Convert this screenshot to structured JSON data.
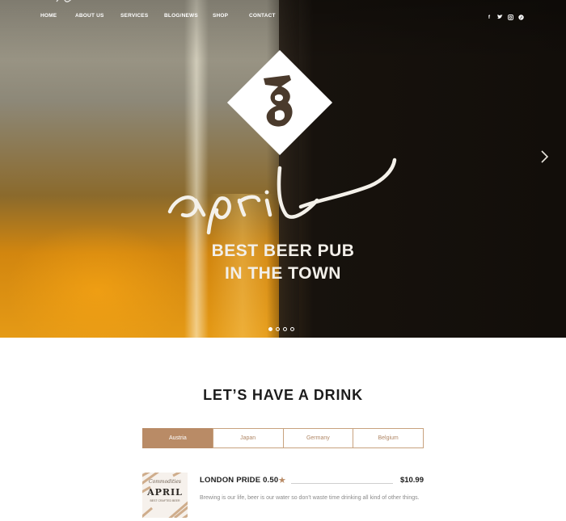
{
  "nav": {
    "items": [
      {
        "label": "HOME"
      },
      {
        "label": "ABOUT US"
      },
      {
        "label": "SERVICES"
      },
      {
        "label": "BLOG/NEWS"
      },
      {
        "label": "SHOP"
      },
      {
        "label": "CONTACT"
      }
    ]
  },
  "social": {
    "icons": [
      {
        "name": "facebook-icon",
        "glyph": "f"
      },
      {
        "name": "twitter-icon",
        "glyph": "ᵛ"
      },
      {
        "name": "instagram-icon",
        "glyph": "▣"
      },
      {
        "name": "pinterest-icon",
        "glyph": "☉"
      }
    ]
  },
  "hero": {
    "script_word": "april",
    "tagline_line1": "BEST BEER PUB",
    "tagline_line2": "IN THE TOWN",
    "slides_total": 4,
    "slide_active": 1
  },
  "menu": {
    "heading": "LET’S HAVE A DRINK",
    "tabs": [
      {
        "label": "Austria",
        "active": true
      },
      {
        "label": "Japan",
        "active": false
      },
      {
        "label": "Germany",
        "active": false
      },
      {
        "label": "Belgium",
        "active": false
      }
    ],
    "products": [
      {
        "name": "LONDON PRIDE 0.50",
        "price": "$10.99",
        "description": "Brewing is our life, beer is our water so don’t waste time drinking all kind of other things.",
        "thumb_script": "Commodities",
        "thumb_title": "APRIL",
        "thumb_sub": "BEST CRAFTED BEER"
      }
    ]
  },
  "colors": {
    "accent": "#b98b66",
    "heading": "#1c1c1c",
    "muted": "#8a8a8a"
  }
}
